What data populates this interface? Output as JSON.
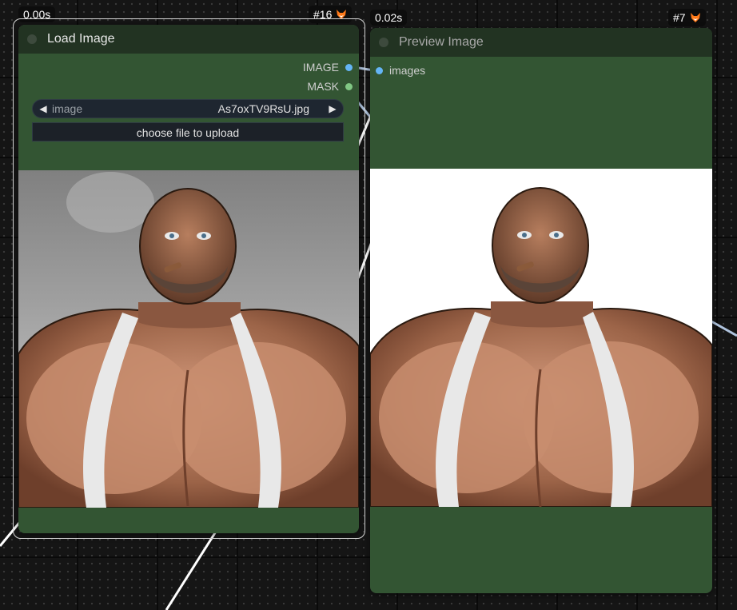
{
  "colors": {
    "canvas_background": "#151515",
    "node_body": "#335533",
    "node_header": "#223322",
    "image_slot": "#64b5f6",
    "mask_slot": "#81c784",
    "link": "#b0c4de"
  },
  "load_image_node": {
    "exec_time": "0.00s",
    "node_id": "#16",
    "badge_icon": "fox-icon",
    "title": "Load Image",
    "outputs": [
      "IMAGE",
      "MASK"
    ],
    "image_widget": {
      "label": "image",
      "value": "As7oxTV9RsU.jpg"
    },
    "upload_button_label": "choose file to upload"
  },
  "preview_image_node": {
    "exec_time": "0.02s",
    "node_id": "#7",
    "badge_icon": "fox-icon",
    "title": "Preview Image",
    "inputs": [
      "images"
    ]
  }
}
